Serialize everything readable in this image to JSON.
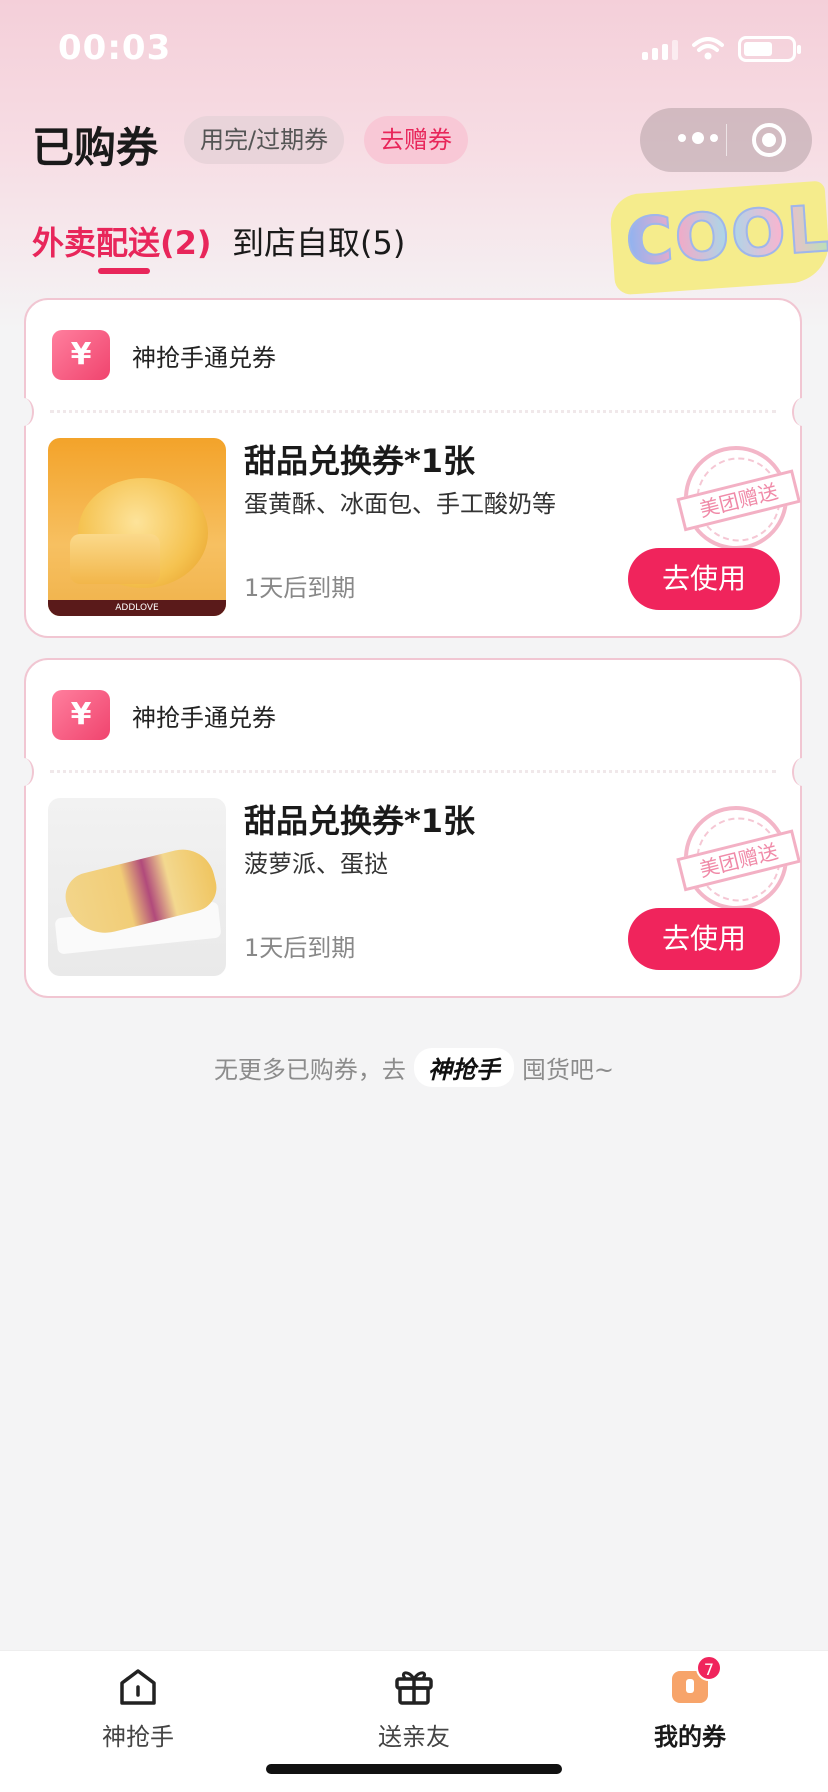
{
  "status_bar": {
    "time": "00:03"
  },
  "header": {
    "title": "已购券",
    "expired_button": "用完/过期券",
    "gift_button": "去赠券"
  },
  "tabs": [
    {
      "label": "外卖配送(2)",
      "active": true
    },
    {
      "label": "到店自取(5)",
      "active": false
    }
  ],
  "decoration": {
    "sticker_text": "COOL"
  },
  "coupons": [
    {
      "source_icon": "yen-icon",
      "source": "神抢手通兑券",
      "title": "甜品兑换券*1张",
      "description": "蛋黄酥、冰面包、手工酸奶等",
      "expiry": "1天后到期",
      "stamp": "美团赠送",
      "action": "去使用",
      "image": "egg-yolk-pastry-image",
      "image_brand": "ADDLOVE"
    },
    {
      "source_icon": "yen-icon",
      "source": "神抢手通兑券",
      "title": "甜品兑换券*1张",
      "description": "菠萝派、蛋挞",
      "expiry": "1天后到期",
      "stamp": "美团赠送",
      "action": "去使用",
      "image": "pineapple-pie-image"
    }
  ],
  "footer_note": {
    "prefix": "无更多已购券，去",
    "brand": "神抢手",
    "suffix": "囤货吧~"
  },
  "bottom_nav": [
    {
      "label": "神抢手",
      "icon": "home-icon",
      "active": false
    },
    {
      "label": "送亲友",
      "icon": "gift-icon",
      "active": false
    },
    {
      "label": "我的券",
      "icon": "ticket-icon",
      "active": true,
      "badge": "7"
    }
  ],
  "colors": {
    "accent": "#f0245c",
    "tab_active": "#e8265a",
    "background": "#f4f4f5"
  }
}
